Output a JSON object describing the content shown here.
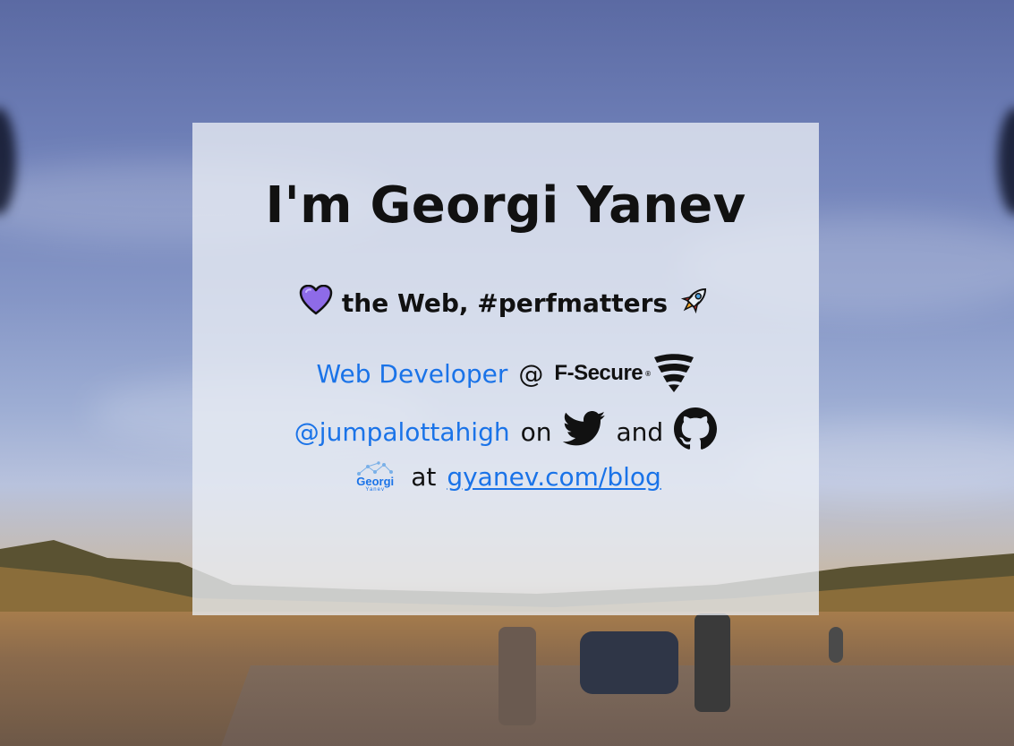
{
  "header": {
    "title": "I'm Georgi Yanev"
  },
  "tagline": {
    "text": "the Web, #perfmatters",
    "heart_icon": "purple-heart",
    "rocket_icon": "rocket",
    "heart_color": "#8e6be8"
  },
  "job": {
    "role_label": "Web Developer",
    "at_label": "@",
    "company_logo_text": "F-Secure",
    "company_logo_mark": "®"
  },
  "social": {
    "handle_label": "@jumpalottahigh",
    "on_label": "on",
    "and_label": "and",
    "twitter_icon": "twitter-bird",
    "github_icon": "github-octocat"
  },
  "blog": {
    "logo_name": "Georgi",
    "logo_sub": "Yanev",
    "at_label": "at",
    "link_label": "gyanev.com/blog"
  },
  "colors": {
    "link": "#1a73e8",
    "text": "#111111",
    "card_bg": "rgba(235,238,245,0.78)"
  }
}
